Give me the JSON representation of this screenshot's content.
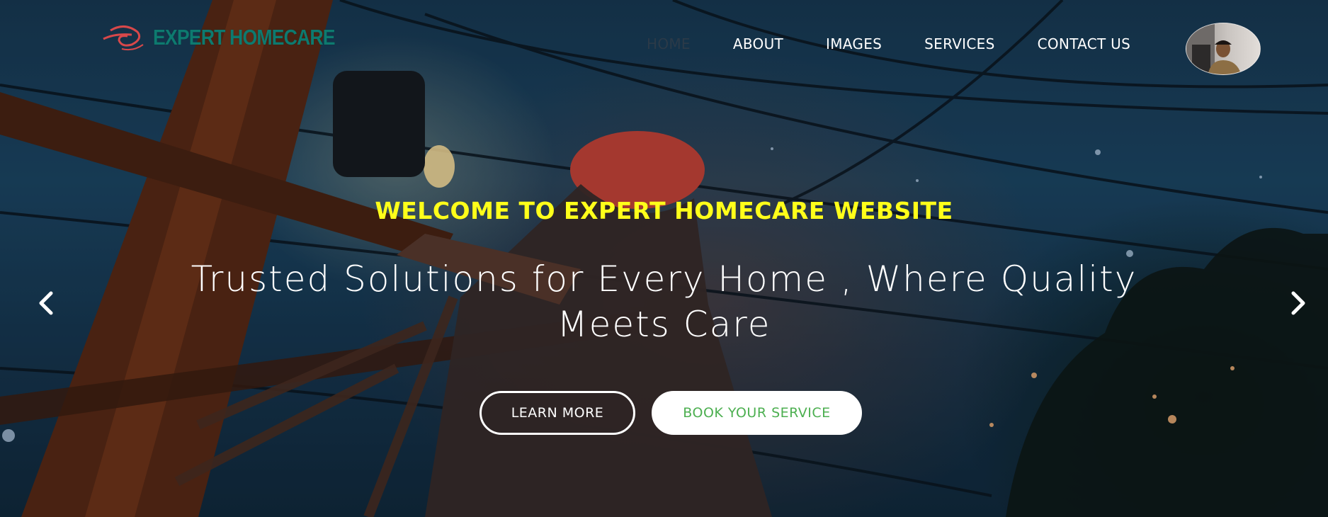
{
  "brand": {
    "name": "EXPERT HOMECARE",
    "logo_icon": "swirl-logo-icon",
    "accent_color": "#0d7a6f"
  },
  "nav": {
    "items": [
      {
        "label": "HOME",
        "active": true
      },
      {
        "label": "ABOUT",
        "active": false
      },
      {
        "label": "IMAGES",
        "active": false
      },
      {
        "label": "SERVICES",
        "active": false
      },
      {
        "label": "CONTACT US",
        "active": false
      }
    ]
  },
  "profile": {
    "icon": "user-avatar"
  },
  "hero": {
    "welcome": "WELCOME TO EXPERT HOMECARE WEBSITE",
    "tagline": "Trusted Solutions for Every Home , Where Quality Meets Care",
    "learn_more": "LEARN MORE",
    "book_service": "BOOK YOUR SERVICE",
    "welcome_color": "#ffff1a",
    "book_color": "#4caf50"
  },
  "carousel": {
    "prev_icon": "chevron-left-icon",
    "next_icon": "chevron-right-icon"
  }
}
